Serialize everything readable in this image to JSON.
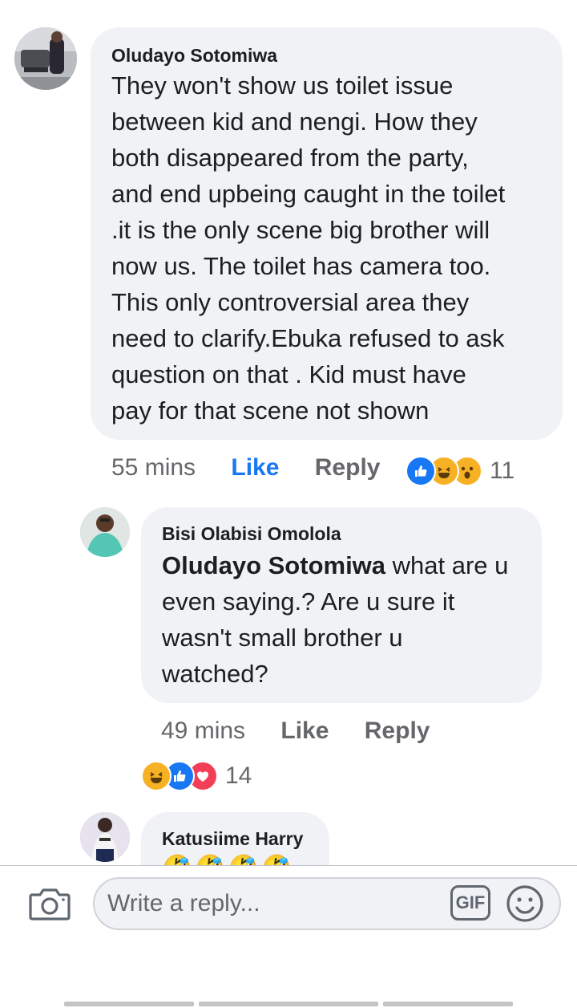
{
  "comment": {
    "author": "Oludayo Sotomiwa",
    "text_lines": [
      "They won't show us toilet issue",
      "between kid and nengi. How they",
      "both disappeared from the party,",
      "and end upbeing caught in the toilet",
      ".it is the only scene big brother will",
      "now us. The toilet has camera too.",
      "This only controversial area they",
      "need to clarify.Ebuka refused to ask",
      "question on that . Kid must have",
      "pay for that scene not shown"
    ],
    "time": "55 mins",
    "like_label": "Like",
    "reply_label": "Reply",
    "reaction_icons": [
      "like-reaction-icon",
      "haha-reaction-icon",
      "wow-reaction-icon"
    ],
    "reaction_count": "11"
  },
  "reply1": {
    "author": "Bisi Olabisi Omolola",
    "mention": "Oludayo Sotomiwa",
    "text_lines_after_mention": [
      " what are u",
      "even saying.? Are u sure it",
      "wasn't small brother u",
      "watched?"
    ],
    "time": "49 mins",
    "like_label": "Like",
    "reply_label": "Reply",
    "reaction_icons": [
      "haha-reaction-icon",
      "like-reaction-icon",
      "love-reaction-icon"
    ],
    "reaction_count": "14"
  },
  "reply2": {
    "author": "Katusiime Harry",
    "text": "🤣🤣🤣🤣"
  },
  "composer": {
    "placeholder": "Write a reply...",
    "gif_label": "GIF"
  },
  "colors": {
    "bubble": "#f0f2f5",
    "like_blue": "#1877f2",
    "meta_gray": "#65676b"
  }
}
